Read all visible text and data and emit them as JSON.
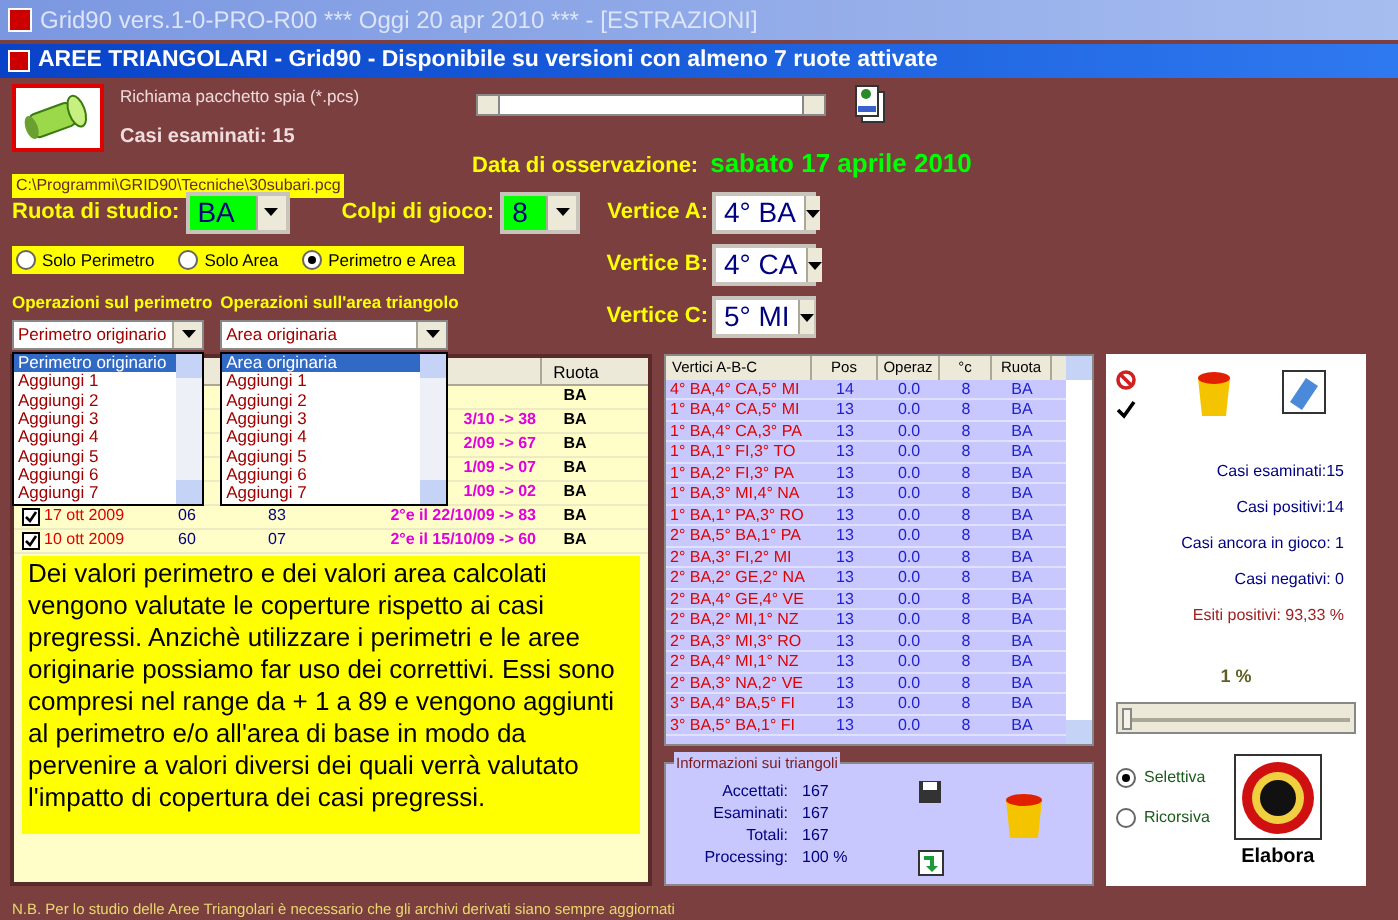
{
  "window": {
    "title": "Grid90 vers.1-0-PRO-R00  ***  Oggi 20 apr 2010  ***  - [ESTRAZIONI]"
  },
  "dialog": {
    "title": "AREE TRIANGOLARI - Grid90 - Disponibile su versioni con almeno 7 ruote attivate"
  },
  "spy_package": {
    "label": "Richiama pacchetto spia (*.pcs)",
    "cases_examined": "Casi esaminati: 15",
    "path": "C:\\Programmi\\GRID90\\Tecniche\\30subari.pcg"
  },
  "observation": {
    "label": "Data di osservazione:",
    "date": "sabato 17 aprile 2010"
  },
  "study_wheel": {
    "label": "Ruota di studio:",
    "value": "BA"
  },
  "play_shots": {
    "label": "Colpi di gioco:",
    "value": "8"
  },
  "vertices": [
    {
      "label": "Vertice A:",
      "value": "4° BA"
    },
    {
      "label": "Vertice B:",
      "value": "4° CA"
    },
    {
      "label": "Vertice C:",
      "value": "5° MI"
    }
  ],
  "mode_radios": [
    {
      "label": "Solo Perimetro",
      "selected": false
    },
    {
      "label": "Solo Area",
      "selected": false
    },
    {
      "label": "Perimetro e Area",
      "selected": true
    }
  ],
  "perimeter_ops": {
    "label": "Operazioni sul perimetro",
    "value": "Perimetro originario",
    "options": [
      {
        "label": "Perimetro originario",
        "selected": true
      },
      {
        "label": "Aggiungi 1",
        "selected": false
      },
      {
        "label": "Aggiungi 2",
        "selected": false
      },
      {
        "label": "Aggiungi 3",
        "selected": false
      },
      {
        "label": "Aggiungi 4",
        "selected": false
      },
      {
        "label": "Aggiungi 5",
        "selected": false
      },
      {
        "label": "Aggiungi 6",
        "selected": false
      },
      {
        "label": "Aggiungi 7",
        "selected": false
      }
    ]
  },
  "area_ops": {
    "label": "Operazioni sull'area triangolo",
    "value": "Area originaria",
    "options": [
      {
        "label": "Area originaria",
        "selected": true
      },
      {
        "label": "Aggiungi 1",
        "selected": false
      },
      {
        "label": "Aggiungi 2",
        "selected": false
      },
      {
        "label": "Aggiungi 3",
        "selected": false
      },
      {
        "label": "Aggiungi 4",
        "selected": false
      },
      {
        "label": "Aggiungi 5",
        "selected": false
      },
      {
        "label": "Aggiungi 6",
        "selected": false
      },
      {
        "label": "Aggiungi 7",
        "selected": false
      }
    ]
  },
  "history_table": {
    "column_5": "Ruota",
    "rows": [
      {
        "cells": [
          "",
          "",
          "",
          "",
          "BA"
        ]
      },
      {
        "cells": [
          "",
          "",
          "",
          "3/10 -> 38",
          "BA"
        ]
      },
      {
        "cells": [
          "",
          "",
          "",
          "2/09 -> 67",
          "BA"
        ]
      },
      {
        "cells": [
          "",
          "",
          "",
          "1/09 -> 07",
          "BA"
        ]
      },
      {
        "cells": [
          "",
          "",
          "",
          "1/09 -> 02",
          "BA"
        ]
      },
      {
        "checked": true,
        "cells": [
          "17 ott 2009",
          "06",
          "83",
          "2°e il 22/10/09 -> 83",
          "BA"
        ]
      },
      {
        "checked": true,
        "cells": [
          "10 ott 2009",
          "60",
          "07",
          "2°e il 15/10/09 -> 60",
          "BA"
        ]
      }
    ]
  },
  "note": "Dei valori perimetro e dei valori area calcolati vengono valutate le coperture rispetto ai casi pregressi. Anzichè utilizzare i perimetri e le aree originarie possiamo far uso dei correttivi. Essi sono compresi nel range da + 1 a  89 e vengono aggiunti al perimetro e/o all'area di base in modo da pervenire a valori diversi dei quali verrà valutato l'impatto di copertura dei casi pregressi.",
  "triangles_table": {
    "columns": [
      "Vertici A-B-C",
      "Pos",
      "Operaz",
      "°c",
      "Ruota"
    ],
    "rows": [
      [
        "4° BA,4° CA,5° MI",
        "14",
        "0.0",
        "8",
        "BA"
      ],
      [
        "1° BA,4° CA,5° MI",
        "13",
        "0.0",
        "8",
        "BA"
      ],
      [
        "1° BA,4° CA,3° PA",
        "13",
        "0.0",
        "8",
        "BA"
      ],
      [
        "1° BA,1° FI,3° TO",
        "13",
        "0.0",
        "8",
        "BA"
      ],
      [
        "1° BA,2° FI,3° PA",
        "13",
        "0.0",
        "8",
        "BA"
      ],
      [
        "1° BA,3° MI,4° NA",
        "13",
        "0.0",
        "8",
        "BA"
      ],
      [
        "1° BA,1° PA,3° RO",
        "13",
        "0.0",
        "8",
        "BA"
      ],
      [
        "2° BA,5° BA,1° PA",
        "13",
        "0.0",
        "8",
        "BA"
      ],
      [
        "2° BA,3° FI,2° MI",
        "13",
        "0.0",
        "8",
        "BA"
      ],
      [
        "2° BA,2° GE,2° NA",
        "13",
        "0.0",
        "8",
        "BA"
      ],
      [
        "2° BA,4° GE,4° VE",
        "13",
        "0.0",
        "8",
        "BA"
      ],
      [
        "2° BA,2° MI,1° NZ",
        "13",
        "0.0",
        "8",
        "BA"
      ],
      [
        "2° BA,3° MI,3° RO",
        "13",
        "0.0",
        "8",
        "BA"
      ],
      [
        "2° BA,4° MI,1° NZ",
        "13",
        "0.0",
        "8",
        "BA"
      ],
      [
        "2° BA,3° NA,2° VE",
        "13",
        "0.0",
        "8",
        "BA"
      ],
      [
        "3° BA,4° BA,5° FI",
        "13",
        "0.0",
        "8",
        "BA"
      ],
      [
        "3° BA,5° BA,1° FI",
        "13",
        "0.0",
        "8",
        "BA"
      ]
    ]
  },
  "triangle_info": {
    "title": "Informazioni sui triangoli",
    "fields": [
      {
        "label": "Accettati:",
        "value": "167"
      },
      {
        "label": "Esaminati:",
        "value": "167"
      },
      {
        "label": "Totali:",
        "value": "167"
      },
      {
        "label": "Processing:",
        "value": "100 %"
      }
    ]
  },
  "results": [
    {
      "kind": "normal",
      "text": "Casi esaminati:15"
    },
    {
      "kind": "normal",
      "text": "Casi positivi:14"
    },
    {
      "kind": "normal",
      "text": "Casi ancora in gioco: 1"
    },
    {
      "kind": "normal",
      "text": "Casi negativi: 0"
    },
    {
      "kind": "highlight",
      "text": "Esiti positivi: 93,33 %"
    }
  ],
  "threshold": {
    "reading": "1 %",
    "level": 0.02
  },
  "method_radios": [
    {
      "label": "Selettiva",
      "selected": true
    },
    {
      "label": "Ricorsiva",
      "selected": false
    }
  ],
  "run_button": {
    "label": "Elabora"
  },
  "footer": "N.B. Per lo studio delle Aree Triangolari è necessario che gli archivi derivati siano sempre aggiornati"
}
